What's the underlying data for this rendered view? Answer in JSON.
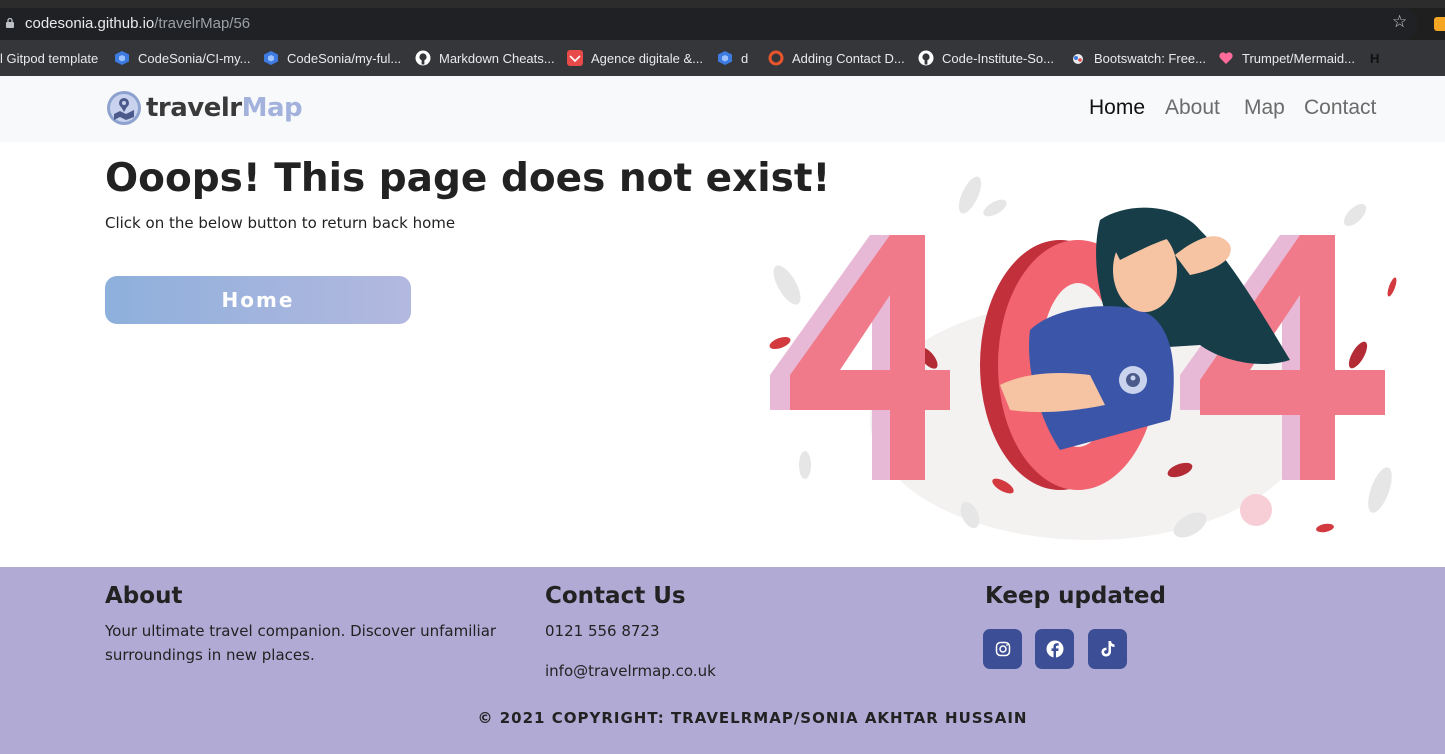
{
  "browser": {
    "url_host": "codesonia.github.io",
    "url_path": "/travelrMap/56",
    "bookmarks": [
      {
        "label": "l Gitpod template",
        "icon": "none"
      },
      {
        "label": "CodeSonia/CI-my...",
        "icon": "cube-icon"
      },
      {
        "label": "CodeSonia/my-ful...",
        "icon": "cube-icon"
      },
      {
        "label": "Markdown Cheats...",
        "icon": "github-icon"
      },
      {
        "label": "Agence digitale &...",
        "icon": "agency-icon"
      },
      {
        "label": "d",
        "icon": "cube-icon"
      },
      {
        "label": "Adding Contact D...",
        "icon": "ring-icon"
      },
      {
        "label": "Code-Institute-So...",
        "icon": "github-icon"
      },
      {
        "label": "Bootswatch: Free...",
        "icon": "bootswatch-icon"
      },
      {
        "label": "Trumpet/Mermaid...",
        "icon": "heart-icon"
      },
      {
        "label": "H",
        "icon": "none"
      }
    ]
  },
  "navbar": {
    "brand_part1": "travelr",
    "brand_part2": "Map",
    "links": [
      "Home",
      "About",
      "Map",
      "Contact"
    ],
    "active": "Home"
  },
  "main": {
    "heading": "Ooops! This page does not exist!",
    "subtext": "Click on the below button to return back home",
    "button_label": "Home",
    "illustration_text": "404"
  },
  "footer": {
    "about_title": "About",
    "about_text_line1": "Your ultimate travel companion. Discover unfamiliar",
    "about_text_line2": "surroundings in new places.",
    "contact_title": "Contact Us",
    "phone": "0121 556 8723",
    "email": "info@travelrmap.co.uk",
    "social_title": "Keep updated",
    "social_icons": [
      "instagram-icon",
      "facebook-icon",
      "tiktok-icon"
    ],
    "copyright": "© 2021 COPYRIGHT: TRAVELRMAP/SONIA AKHTAR HUSSAIN"
  },
  "colors": {
    "navbar_bg": "#f8f9fa",
    "footer_bg": "#b1aad5",
    "button_gradient_start": "#8eb0dc",
    "button_gradient_end": "#b3b8df",
    "social_bg": "#3c4e96",
    "brand_accent": "#a3b2dd"
  }
}
